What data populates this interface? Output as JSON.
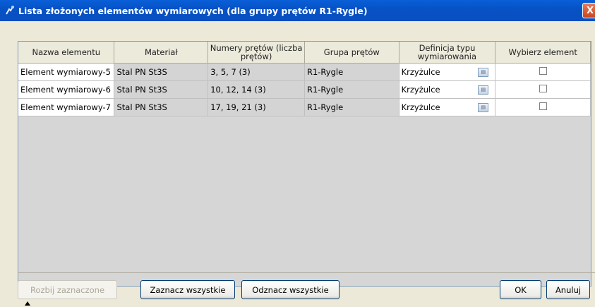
{
  "window": {
    "title": "Lista złożonych elementów wymiarowych (dla grupy prętów R1-Rygle)",
    "close_label": "X"
  },
  "table": {
    "columns": [
      "Nazwa elementu",
      "Materiał",
      "Numery prętów (liczba prętów)",
      "Grupa prętów",
      "Definicja typu wymiarowania",
      "Wybierz element"
    ],
    "rows": [
      [
        "Element wymiarowy-5",
        "Stal PN St3S",
        "3, 5, 7 (3)",
        "R1-Rygle",
        "Krzyżulce",
        false
      ],
      [
        "Element wymiarowy-6",
        "Stal PN St3S",
        "10, 12, 14 (3)",
        "R1-Rygle",
        "Krzyżulce",
        false
      ],
      [
        "Element wymiarowy-7",
        "Stal PN St3S",
        "17, 19, 21 (3)",
        "R1-Rygle",
        "Krzyżulce",
        false
      ]
    ]
  },
  "buttons": {
    "split_selected": "Rozbij zaznaczone",
    "select_all": "Zaznacz wszystkie",
    "deselect_all": "Odznacz wszystkie",
    "ok": "OK",
    "cancel": "Anuluj"
  },
  "colors": {
    "titlebar": "#0a5fd8",
    "frame": "#ece9d8",
    "grid_background": "#d6d6d6"
  },
  "icons": {
    "title": "robot-app-icon",
    "close": "close-icon",
    "definition": "dialog-button-icon"
  }
}
